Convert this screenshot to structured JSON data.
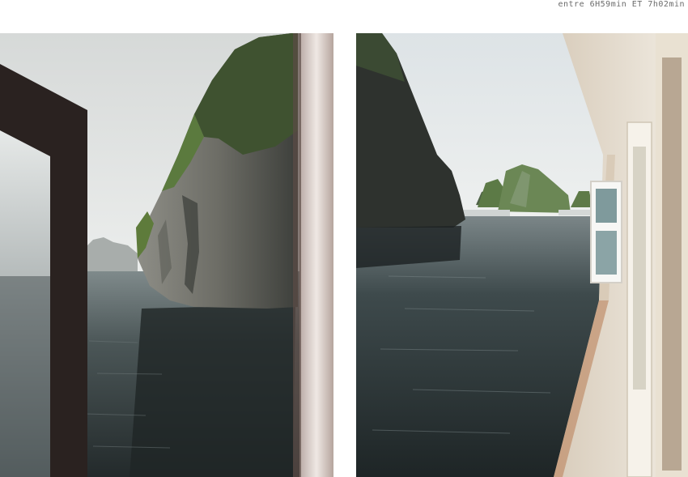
{
  "caption": {
    "text": "entre 6H59min ET 7h02min"
  },
  "photos": [
    {
      "id": "left",
      "subject": "karst-rock-through-boat-window"
    },
    {
      "id": "right",
      "subject": "bay-view-from-boat-deck"
    }
  ],
  "colors": {
    "sky": "#e4e7e6",
    "water": "#3b4648",
    "rock": "#4a4d48",
    "foliage": "#4f6b3a",
    "window_frame": "#2a2220",
    "hull": "#ece6db"
  }
}
